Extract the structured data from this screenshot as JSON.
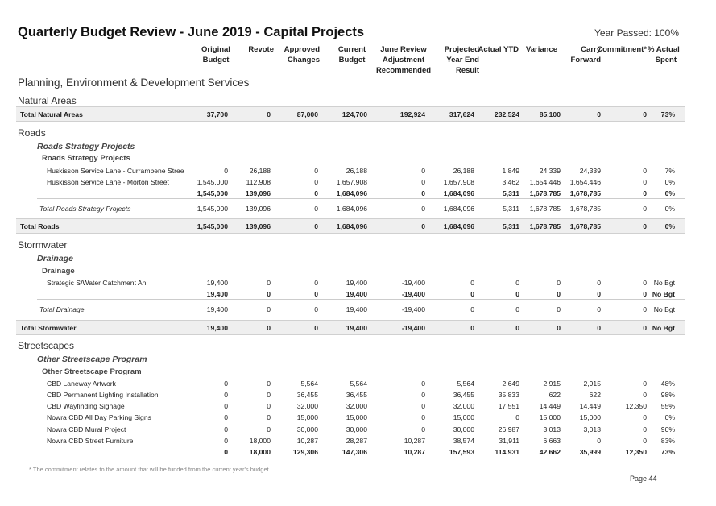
{
  "title": "Quarterly Budget Review - June 2019 - Capital Projects",
  "year_passed": "Year Passed: 100%",
  "columns": [
    [
      "Original",
      "Budget"
    ],
    [
      "Revote"
    ],
    [
      "Approved",
      "Changes"
    ],
    [
      "Current",
      "Budget"
    ],
    [
      "June Review",
      "Adjustment",
      "Recommended"
    ],
    [
      "Projected",
      "Year End",
      "Result"
    ],
    [
      "Actual YTD"
    ],
    [
      "Variance"
    ],
    [
      "Carry",
      "Forward"
    ],
    [
      "Commitment*"
    ],
    [
      "% Actual",
      "Spent"
    ]
  ],
  "rows": [
    {
      "type": "section",
      "label": "Planning, Environment & Development Services"
    },
    {
      "type": "group",
      "label": "Natural Areas"
    },
    {
      "type": "band",
      "label": "Total Natural Areas",
      "values": [
        "37,700",
        "0",
        "87,000",
        "124,700",
        "192,924",
        "317,624",
        "232,524",
        "85,100",
        "0",
        "0",
        "73%"
      ]
    },
    {
      "type": "group",
      "label": "Roads"
    },
    {
      "type": "italic-sub",
      "label": "Roads Strategy Projects"
    },
    {
      "type": "bold-sub",
      "label": "Roads Strategy Projects"
    },
    {
      "type": "item",
      "label": "Huskisson Service Lane - Currambene Stree",
      "values": [
        "0",
        "26,188",
        "0",
        "26,188",
        "0",
        "26,188",
        "1,849",
        "24,339",
        "24,339",
        "0",
        "7%"
      ]
    },
    {
      "type": "item",
      "label": "Huskisson Service Lane - Morton Street",
      "values": [
        "1,545,000",
        "112,908",
        "0",
        "1,657,908",
        "0",
        "1,657,908",
        "3,462",
        "1,654,446",
        "1,654,446",
        "0",
        "0%"
      ]
    },
    {
      "type": "subtotal",
      "label": "",
      "values": [
        "1,545,000",
        "139,096",
        "0",
        "1,684,096",
        "0",
        "1,684,096",
        "5,311",
        "1,678,785",
        "1,678,785",
        "0",
        "0%"
      ]
    },
    {
      "type": "italic-total",
      "label": "Total Roads Strategy Projects",
      "values": [
        "1,545,000",
        "139,096",
        "0",
        "1,684,096",
        "0",
        "1,684,096",
        "5,311",
        "1,678,785",
        "1,678,785",
        "0",
        "0%"
      ]
    },
    {
      "type": "band",
      "label": "Total Roads",
      "values": [
        "1,545,000",
        "139,096",
        "0",
        "1,684,096",
        "0",
        "1,684,096",
        "5,311",
        "1,678,785",
        "1,678,785",
        "0",
        "0%"
      ]
    },
    {
      "type": "group",
      "label": "Stormwater"
    },
    {
      "type": "italic-sub",
      "label": "Drainage"
    },
    {
      "type": "bold-sub",
      "label": "Drainage"
    },
    {
      "type": "item",
      "label": "Strategic S/Water Catchment An",
      "values": [
        "19,400",
        "0",
        "0",
        "19,400",
        "-19,400",
        "0",
        "0",
        "0",
        "0",
        "0",
        "No Bgt"
      ]
    },
    {
      "type": "subtotal",
      "label": "",
      "values": [
        "19,400",
        "0",
        "0",
        "19,400",
        "-19,400",
        "0",
        "0",
        "0",
        "0",
        "0",
        "No Bgt"
      ]
    },
    {
      "type": "italic-total",
      "label": "Total Drainage",
      "values": [
        "19,400",
        "0",
        "0",
        "19,400",
        "-19,400",
        "0",
        "0",
        "0",
        "0",
        "0",
        "No Bgt"
      ]
    },
    {
      "type": "band",
      "label": "Total Stormwater",
      "values": [
        "19,400",
        "0",
        "0",
        "19,400",
        "-19,400",
        "0",
        "0",
        "0",
        "0",
        "0",
        "No Bgt"
      ]
    },
    {
      "type": "group",
      "label": "Streetscapes"
    },
    {
      "type": "italic-sub",
      "label": "Other Streetscape Program"
    },
    {
      "type": "bold-sub",
      "label": "Other Streetscape Program"
    },
    {
      "type": "item",
      "label": "CBD Laneway Artwork",
      "values": [
        "0",
        "0",
        "5,564",
        "5,564",
        "0",
        "5,564",
        "2,649",
        "2,915",
        "2,915",
        "0",
        "48%"
      ]
    },
    {
      "type": "item",
      "label": "CBD Permanent Lighting Installation",
      "values": [
        "0",
        "0",
        "36,455",
        "36,455",
        "0",
        "36,455",
        "35,833",
        "622",
        "622",
        "0",
        "98%"
      ]
    },
    {
      "type": "item",
      "label": "CBD Wayfinding Signage",
      "values": [
        "0",
        "0",
        "32,000",
        "32,000",
        "0",
        "32,000",
        "17,551",
        "14,449",
        "14,449",
        "12,350",
        "55%"
      ]
    },
    {
      "type": "item",
      "label": "Nowra CBD All Day Parking Signs",
      "values": [
        "0",
        "0",
        "15,000",
        "15,000",
        "0",
        "15,000",
        "0",
        "15,000",
        "15,000",
        "0",
        "0%"
      ]
    },
    {
      "type": "item",
      "label": "Nowra CBD Mural Project",
      "values": [
        "0",
        "0",
        "30,000",
        "30,000",
        "0",
        "30,000",
        "26,987",
        "3,013",
        "3,013",
        "0",
        "90%"
      ]
    },
    {
      "type": "item",
      "label": "Nowra CBD Street Furniture",
      "values": [
        "0",
        "18,000",
        "10,287",
        "28,287",
        "10,287",
        "38,574",
        "31,911",
        "6,663",
        "0",
        "0",
        "83%"
      ]
    },
    {
      "type": "subtotal",
      "label": "",
      "values": [
        "0",
        "18,000",
        "129,306",
        "147,306",
        "10,287",
        "157,593",
        "114,931",
        "42,662",
        "35,999",
        "12,350",
        "73%"
      ]
    }
  ],
  "footnote": "* The commitment relates to the amount that will be funded from the current year's budget",
  "page": "Page 44"
}
